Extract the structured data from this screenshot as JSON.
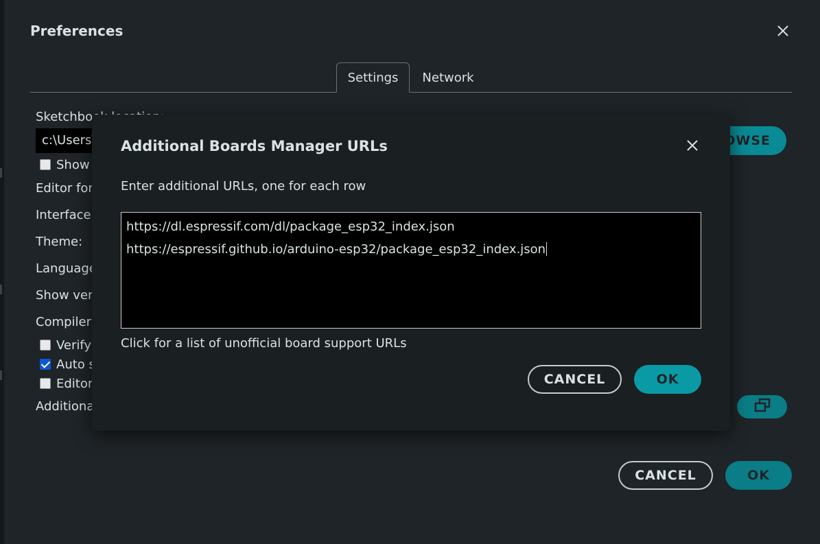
{
  "preferences": {
    "title": "Preferences",
    "close_icon": "close-icon",
    "tabs": [
      {
        "label": "Settings",
        "active": true
      },
      {
        "label": "Network",
        "active": false
      }
    ],
    "settings": {
      "sketchbook_label": "Sketchbook location:",
      "sketchbook_path": "c:\\Users\\",
      "browse_label": "BROWSE",
      "show_files_label": "Show",
      "editor_font_label": "Editor font",
      "interface_scale_label": "Interface s",
      "theme_label": "Theme:",
      "language_label": "Language",
      "show_verbose_label": "Show verl",
      "compiler_label": "Compiler",
      "verify_label": "Verify",
      "verify_checked": false,
      "autosave_label": "Auto s",
      "autosave_checked": true,
      "editor_quick_label": "Editor",
      "editor_quick_checked": false,
      "additional_label": "Additiona",
      "open_urls_icon": "window-restore-icon"
    },
    "cancel_label": "CANCEL",
    "ok_label": "OK"
  },
  "dialog": {
    "title": "Additional Boards Manager URLs",
    "close_icon": "close-icon",
    "description": "Enter additional URLs, one for each row",
    "urls": [
      "https://dl.espressif.com/dl/package_esp32_index.json",
      "https://espressif.github.io/arduino-esp32/package_esp32_index.json"
    ],
    "link_text": "Click for a list of unofficial board support URLs",
    "cancel_label": "CANCEL",
    "ok_label": "OK"
  },
  "colors": {
    "background": "#1f2428",
    "accent": "#0a9aa6",
    "dialog_background": "#1a1f22"
  }
}
